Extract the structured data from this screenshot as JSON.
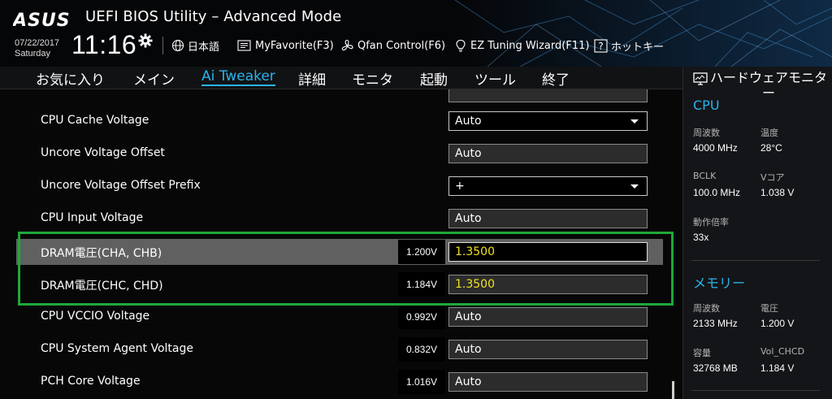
{
  "header": {
    "brand": "ASUS",
    "title": "UEFI BIOS Utility – Advanced Mode",
    "date": "07/22/2017",
    "day": "Saturday",
    "time": "11:16",
    "tools": [
      {
        "label": "日本語",
        "icon": "globe-icon"
      },
      {
        "label": "MyFavorite(F3)",
        "icon": "favorite-list-icon"
      },
      {
        "label": "Qfan Control(F6)",
        "icon": "fan-icon"
      },
      {
        "label": "EZ Tuning Wizard(F11)",
        "icon": "lightbulb-icon"
      },
      {
        "label": "ホットキー",
        "icon": "help-icon"
      }
    ]
  },
  "menu": {
    "items": [
      "お気に入り",
      "メイン",
      "Ai Tweaker",
      "詳細",
      "モニタ",
      "起動",
      "ツール",
      "終了"
    ],
    "active": "Ai Tweaker"
  },
  "settings": [
    {
      "label": "CPU Cache Voltage",
      "current": "",
      "value": "Auto",
      "type": "select"
    },
    {
      "label": "Uncore Voltage Offset",
      "current": "",
      "value": "Auto",
      "type": "input"
    },
    {
      "label": "Uncore Voltage Offset Prefix",
      "current": "",
      "value": "+",
      "type": "select"
    },
    {
      "label": "CPU Input Voltage",
      "current": "",
      "value": "Auto",
      "type": "input"
    },
    {
      "label": "DRAM電圧(CHA, CHB)",
      "current": "1.200V",
      "value": "1.3500",
      "type": "input",
      "selected": true,
      "highlight": "#f0e020"
    },
    {
      "label": "DRAM電圧(CHC, CHD)",
      "current": "1.184V",
      "value": "1.3500",
      "type": "input",
      "highlight": "#f0e020"
    },
    {
      "label": "CPU VCCIO Voltage",
      "current": "0.992V",
      "value": "Auto",
      "type": "input"
    },
    {
      "label": "CPU System Agent Voltage",
      "current": "0.832V",
      "value": "Auto",
      "type": "input"
    },
    {
      "label": "PCH Core Voltage",
      "current": "1.016V",
      "value": "Auto",
      "type": "input"
    }
  ],
  "hardware_monitor": {
    "title": "ハードウェアモニター",
    "cpu": {
      "section": "CPU",
      "freq_label": "周波数",
      "freq_value": "4000 MHz",
      "temp_label": "温度",
      "temp_value": "28°C",
      "bclk_label": "BCLK",
      "bclk_value": "100.0 MHz",
      "vcore_label": "Vコア",
      "vcore_value": "1.038 V",
      "ratio_label": "動作倍率",
      "ratio_value": "33x"
    },
    "memory": {
      "section": "メモリー",
      "freq_label": "周波数",
      "freq_value": "2133 MHz",
      "volt_label": "電圧",
      "volt_value": "1.200 V",
      "cap_label": "容量",
      "cap_value": "32768 MB",
      "vol_chcd_label": "Vol_CHCD",
      "vol_chcd_value": "1.184 V"
    }
  },
  "colors": {
    "accent": "#2bb3ea",
    "highlight_value": "#f0e020",
    "annotation_box": "#1fa83a",
    "selected_row": "#606060"
  }
}
